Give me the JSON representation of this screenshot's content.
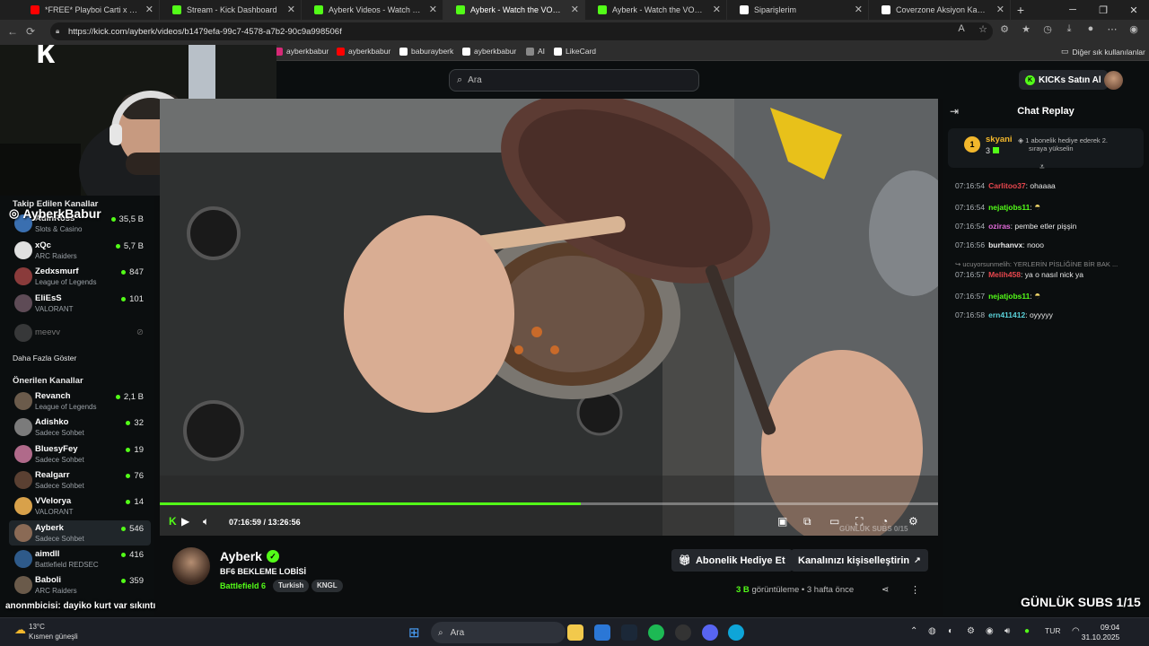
{
  "browser": {
    "tabs": [
      {
        "label": "*FREE* Playboi Carti x F1lthy Typ",
        "color": "#ff0000",
        "active": false
      },
      {
        "label": "Stream - Kick Dashboard",
        "color": "#53fc18",
        "active": false
      },
      {
        "label": "Ayberk Videos - Watch On-Demand",
        "color": "#53fc18",
        "active": false
      },
      {
        "label": "Ayberk - Watch the VOD on Kick",
        "color": "#53fc18",
        "active": true
      },
      {
        "label": "Ayberk - Watch the VOD on Kick",
        "color": "#53fc18",
        "active": false
      },
      {
        "label": "Siparişlerim",
        "color": "#ffffff",
        "active": false
      },
      {
        "label": "Coverzone Aksiyon Kamera ve Te",
        "color": "#ffffff",
        "active": false
      }
    ],
    "new_tab": "+",
    "url": "https://kick.com/ayberk/videos/b1479efa-99c7-4578-a7b2-90c9a998506f",
    "bookmarks": [
      {
        "label": "ayberkbabur",
        "color": "#d62976"
      },
      {
        "label": "ayberkbabur",
        "color": "#ff0000"
      },
      {
        "label": "baburayberk",
        "color": "#ffffff"
      },
      {
        "label": "ayberkbabur",
        "color": "#ffffff"
      },
      {
        "label": "AI",
        "color": "#888888"
      },
      {
        "label": "LikeCard",
        "color": "#ffffff"
      }
    ],
    "other_bookmarks": "Diğer sık kullanılanlar"
  },
  "header": {
    "search_placeholder": "Ara",
    "kicks_button": "KICKs Satın Al",
    "kicks_icon": "K"
  },
  "sidebar": {
    "followed_title": "Takip Edilen Kanallar",
    "followed": [
      {
        "name": "AdinRoss",
        "category": "Slots & Casino",
        "viewers": "35,5 B",
        "color": "#3a6fb0"
      },
      {
        "name": "xQc",
        "category": "ARC Raiders",
        "viewers": "5,7 B",
        "color": "#e0e0e0"
      },
      {
        "name": "Zedxsmurf",
        "category": "League of Legends",
        "viewers": "847",
        "color": "#8a3b3b"
      },
      {
        "name": "EliEsS",
        "category": "VALORANT",
        "viewers": "101",
        "color": "#5e4b56"
      }
    ],
    "offline": {
      "name": "meevv"
    },
    "show_more": "Daha Fazla Göster",
    "suggested_title": "Önerilen Kanallar",
    "suggested": [
      {
        "name": "Revanch",
        "category": "League of Legends",
        "viewers": "2,1 B",
        "color": "#6b5b4b"
      },
      {
        "name": "Adishko",
        "category": "Sadece Sohbet",
        "viewers": "32",
        "color": "#7b7b7b"
      },
      {
        "name": "BluesyFey",
        "category": "Sadece Sohbet",
        "viewers": "19",
        "color": "#b06a8a"
      },
      {
        "name": "Realgarr",
        "category": "Sadece Sohbet",
        "viewers": "76",
        "color": "#5a4032"
      },
      {
        "name": "VVelorya",
        "category": "VALORANT",
        "viewers": "14",
        "color": "#d8a14a"
      },
      {
        "name": "Ayberk",
        "category": "Sadece Sohbet",
        "viewers": "546",
        "color": "#8a6a55"
      },
      {
        "name": "aimdll",
        "category": "Battlefield REDSEC",
        "viewers": "416",
        "color": "#2e5a8a"
      },
      {
        "name": "Baboli",
        "category": "ARC Raiders",
        "viewers": "359",
        "color": "#6a5a4a"
      }
    ]
  },
  "player": {
    "current_time": "07:16:59",
    "duration": "13:26:56",
    "progress_fraction": 0.541,
    "vod_overlay": "GÜNLÜK SUBS 0/15"
  },
  "stream": {
    "streamer": "Ayberk",
    "verified_icon": "✓",
    "title": "BF6 BEKLEME LOBİSİ",
    "game": "Battlefield 6",
    "tags": [
      "Turkish",
      "KNGL"
    ],
    "gift_button": "Abonelik Hediye Et",
    "customize_button": "Kanalınızı kişiselleştirin",
    "views_count": "3 B",
    "views_label": "görüntüleme",
    "age": "3 hafta önce"
  },
  "chat": {
    "title": "Chat Replay",
    "pinned": {
      "rank": "1",
      "user": "skyani",
      "count": "3",
      "text_line1": "1 abonelik hediye ederek 2.",
      "text_line2": "sıraya yükselin"
    },
    "messages": [
      {
        "time": "07:16:54",
        "user": "Carlitoo37",
        "color": "#e8474e",
        "text": "ohaaaa",
        "emote": false
      },
      {
        "time": "07:16:54",
        "user": "nejatjobs11",
        "color": "#53fc18",
        "text": "",
        "emote": true
      },
      {
        "time": "07:16:54",
        "user": "oziras",
        "color": "#e06ad8",
        "text": "pembe etler pişşin",
        "emote": false
      },
      {
        "time": "07:16:56",
        "user": "burhanvx",
        "color": "#e8e8e8",
        "text": "nooo",
        "emote": false
      },
      {
        "time": "07:16:57",
        "user": "Melih458",
        "color": "#e8474e",
        "text": "ya o nasıl nick ya",
        "emote": false,
        "reply": "ucuyorsunmelih: YERLERİN PİSLİĞİNE BİR BAK ..."
      },
      {
        "time": "07:16:57",
        "user": "nejatjobs11",
        "color": "#53fc18",
        "text": "",
        "emote": true
      },
      {
        "time": "07:16:58",
        "user": "ern411412",
        "color": "#5ad0d8",
        "text": "oyyyyy",
        "emote": false
      }
    ]
  },
  "overlays": {
    "instagram_handle": "AyberkBabur",
    "daily_subs": "GÜNLÜK SUBS 1/15",
    "alert": "anonmbicisi: dayiko kurt var sıkıntı"
  },
  "taskbar": {
    "temperature": "13°C",
    "weather": "Kısmen güneşli",
    "search": "Ara",
    "language": "TUR",
    "time": "09:04",
    "date": "31.10.2025"
  }
}
